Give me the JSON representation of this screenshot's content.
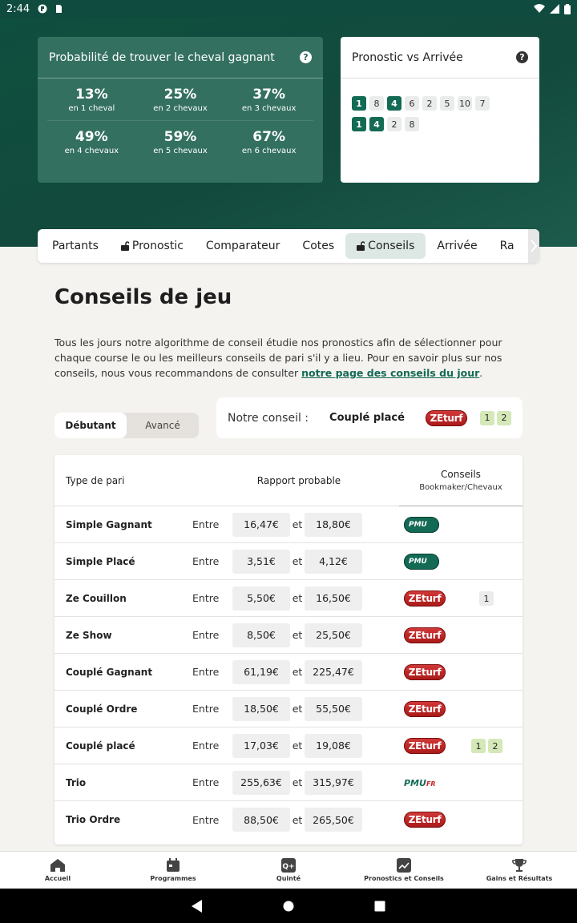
{
  "status": {
    "time": "2:44"
  },
  "proba": {
    "title": "Probabilité de trouver le cheval gagnant",
    "cells": [
      {
        "pct": "13%",
        "label": "en 1 cheval"
      },
      {
        "pct": "25%",
        "label": "en 2 chevaux"
      },
      {
        "pct": "37%",
        "label": "en 3 chevaux"
      },
      {
        "pct": "49%",
        "label": "en 4 chevaux"
      },
      {
        "pct": "59%",
        "label": "en 5 chevaux"
      },
      {
        "pct": "67%",
        "label": "en 6 chevaux"
      }
    ]
  },
  "pronos": {
    "title": "Pronostic vs Arrivée",
    "row1": [
      {
        "n": "1",
        "hit": true
      },
      {
        "n": "8",
        "hit": false
      },
      {
        "n": "4",
        "hit": true
      },
      {
        "n": "6",
        "hit": false
      },
      {
        "n": "2",
        "hit": false
      },
      {
        "n": "5",
        "hit": false
      },
      {
        "n": "10",
        "hit": false
      },
      {
        "n": "7",
        "hit": false
      }
    ],
    "row2": [
      {
        "n": "1",
        "hit": true
      },
      {
        "n": "4",
        "hit": true
      },
      {
        "n": "2",
        "hit": false
      },
      {
        "n": "8",
        "hit": false
      }
    ]
  },
  "tabs": [
    "Partants",
    "Pronostic",
    "Comparateur",
    "Cotes",
    "Conseils",
    "Arrivée",
    "Ra"
  ],
  "main": {
    "title": "Conseils de jeu",
    "intro": "Tous les jours notre algorithme de conseil étudie nos pronostics afin de sélectionner pour chaque course le ou les meilleurs conseils de pari s'il y a lieu. Pour en savoir plus sur nos conseils, nous vous recommandons de consulter ",
    "intro_link": "notre page des conseils du jour",
    "intro_end": ".",
    "toggle": [
      "Débutant",
      "Avancé"
    ],
    "advice": {
      "label": "Notre conseil :",
      "value": "Couplé placé",
      "bookmaker": "ZEturf",
      "nums": [
        "1",
        "2"
      ]
    }
  },
  "table": {
    "headers": {
      "type": "Type de pari",
      "rapport": "Rapport probable",
      "conseils": "Conseils",
      "conseils_sub": "Bookmaker/Chevaux"
    },
    "entre": "Entre",
    "et": "et",
    "rows": [
      {
        "name": "Simple Gagnant",
        "min": "16,47€",
        "max": "18,80€",
        "logo": "pmu-badge",
        "nums": []
      },
      {
        "name": "Simple Placé",
        "min": "3,51€",
        "max": "4,12€",
        "logo": "pmu-badge",
        "nums": []
      },
      {
        "name": "Ze Couillon",
        "min": "5,50€",
        "max": "16,50€",
        "logo": "zeturf",
        "nums": [
          "1"
        ],
        "numStyle": "grey"
      },
      {
        "name": "Ze Show",
        "min": "8,50€",
        "max": "25,50€",
        "logo": "zeturf",
        "nums": []
      },
      {
        "name": "Couplé Gagnant",
        "min": "61,19€",
        "max": "225,47€",
        "logo": "zeturf",
        "nums": []
      },
      {
        "name": "Couplé Ordre",
        "min": "18,50€",
        "max": "55,50€",
        "logo": "zeturf",
        "nums": []
      },
      {
        "name": "Couplé placé",
        "min": "17,03€",
        "max": "19,08€",
        "logo": "zeturf",
        "nums": [
          "1",
          "2"
        ],
        "numStyle": "green"
      },
      {
        "name": "Trio",
        "min": "255,63€",
        "max": "315,97€",
        "logo": "pmufr",
        "nums": []
      },
      {
        "name": "Trio Ordre",
        "min": "88,50€",
        "max": "265,50€",
        "logo": "zeturf",
        "nums": []
      }
    ],
    "logo_text": {
      "zeturf": "ZEturf",
      "pmu_badge": "PMU",
      "pmufr_main": "PMU",
      "pmufr_suffix": "FR"
    }
  },
  "bottom_nav": [
    {
      "label": "Accueil",
      "icon": "home-icon"
    },
    {
      "label": "Programmes",
      "icon": "calendar-icon"
    },
    {
      "label": "Quinté",
      "icon": "quinte-icon"
    },
    {
      "label": "Pronostics et Conseils",
      "icon": "chart-icon"
    },
    {
      "label": "Gains et Résultats",
      "icon": "trophy-icon"
    }
  ]
}
